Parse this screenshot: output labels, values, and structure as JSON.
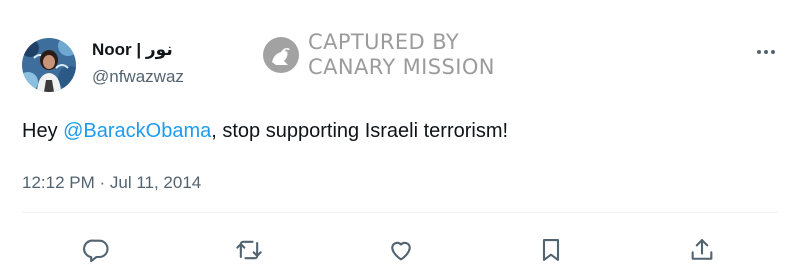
{
  "tweet": {
    "display_name": "Noor | نور",
    "handle": "@nfwazwaz",
    "text": {
      "before": "Hey ",
      "mention": "@BarackObama",
      "after": ", stop supporting Israeli terrorism!"
    },
    "timestamp": "12:12 PM · Jul 11, 2014"
  },
  "watermark": {
    "line1": "CAPTURED BY",
    "line2": "CANARY MISSION"
  },
  "icons": {
    "more": "more-icon",
    "reply": "reply-icon",
    "retweet": "retweet-icon",
    "like": "heart-icon",
    "bookmark": "bookmark-icon",
    "share": "share-icon"
  },
  "colors": {
    "text": "#0f1419",
    "secondary": "#536471",
    "link": "#1d9bf0"
  }
}
